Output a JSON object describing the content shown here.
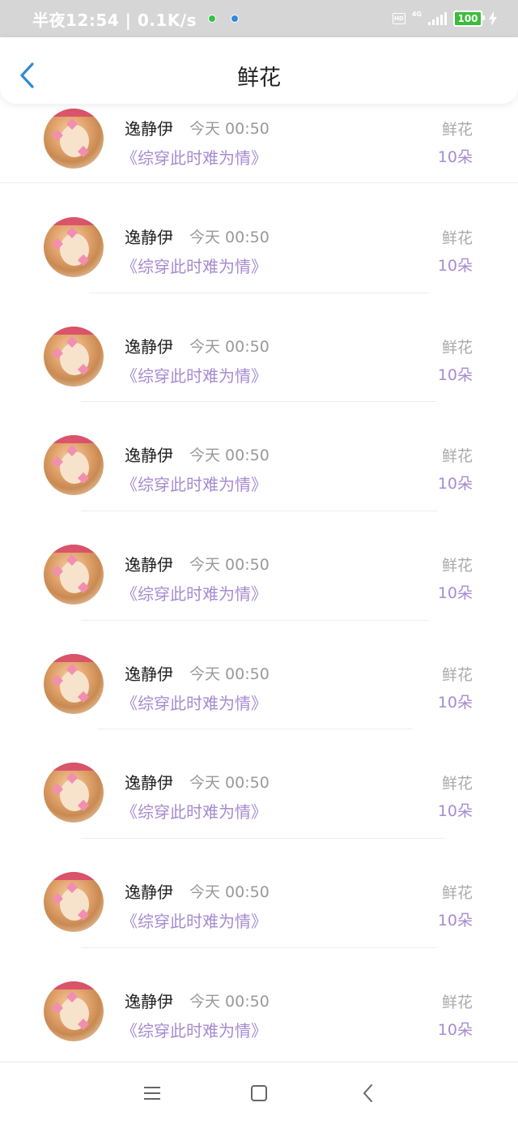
{
  "status_bar": {
    "time_text": "半夜12:54 | 0.1K/s",
    "hd_label": "HD",
    "network_label": "4G",
    "battery_level": "100"
  },
  "header": {
    "title": "鲜花",
    "back_icon": "chevron-left-icon",
    "accent_color": "#2f8bd8"
  },
  "items": [
    {
      "name": "逸静伊",
      "time": "今天 00:50",
      "book": "《综穿此时难为情》",
      "gift": "鲜花",
      "count": "10朵"
    },
    {
      "name": "逸静伊",
      "time": "今天 00:50",
      "book": "《综穿此时难为情》",
      "gift": "鲜花",
      "count": "10朵"
    },
    {
      "name": "逸静伊",
      "time": "今天 00:50",
      "book": "《综穿此时难为情》",
      "gift": "鲜花",
      "count": "10朵"
    },
    {
      "name": "逸静伊",
      "time": "今天 00:50",
      "book": "《综穿此时难为情》",
      "gift": "鲜花",
      "count": "10朵"
    },
    {
      "name": "逸静伊",
      "time": "今天 00:50",
      "book": "《综穿此时难为情》",
      "gift": "鲜花",
      "count": "10朵"
    },
    {
      "name": "逸静伊",
      "time": "今天 00:50",
      "book": "《综穿此时难为情》",
      "gift": "鲜花",
      "count": "10朵"
    },
    {
      "name": "逸静伊",
      "time": "今天 00:50",
      "book": "《综穿此时难为情》",
      "gift": "鲜花",
      "count": "10朵"
    },
    {
      "name": "逸静伊",
      "time": "今天 00:50",
      "book": "《综穿此时难为情》",
      "gift": "鲜花",
      "count": "10朵"
    },
    {
      "name": "逸静伊",
      "time": "今天 00:50",
      "book": "《综穿此时难为情》",
      "gift": "鲜花",
      "count": "10朵"
    }
  ],
  "nav": {
    "menu_icon": "menu-icon",
    "home_icon": "home-square-icon",
    "back_icon": "back-triangle-icon"
  },
  "colors": {
    "book_title": "#a78bd0",
    "gift_label": "#aaaaaa",
    "status_bar_bg": "#d6d6d6"
  }
}
